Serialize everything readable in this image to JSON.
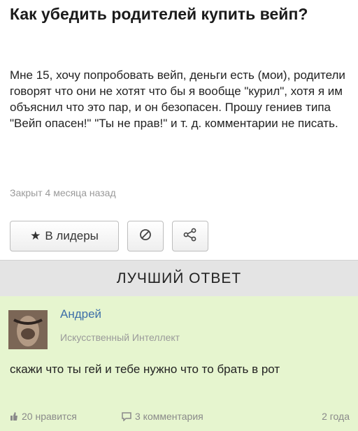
{
  "question": {
    "title": "Как убедить родителей купить вейп?",
    "body": "Мне 15, хочу попробовать вейп, деньги есть (мои), родители говорят что они не хотят что бы я вообще \"курил\", хотя я им объяснил что это пар, и он безопасен. Прошу гениев типа \"Вейп опасен!\" \"Ты не прав!\" и т. д. комментарии не писать.",
    "meta": "Закрыт 4 месяца назад"
  },
  "actions": {
    "leaders_label": "В лидеры"
  },
  "best_answer": {
    "header": "ЛУЧШИЙ ОТВЕТ",
    "author": "Андрей",
    "rank": "Искусственный Интеллект",
    "text": "скажи что ты гей и тебе нужно что то брать в рот",
    "likes": "20 нравится",
    "comments": "3 комментария",
    "age": "2 года"
  },
  "colors": {
    "answer_bg": "#e6f5cf",
    "header_bg": "#e4e4e4",
    "author_link": "#3e6fa8",
    "muted": "#9a9a9a"
  },
  "icons": [
    "star-icon",
    "block-icon",
    "share-icon",
    "like-icon",
    "comment-icon"
  ]
}
